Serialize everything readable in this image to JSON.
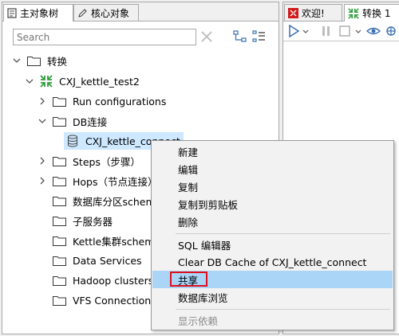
{
  "left_tabs": [
    {
      "label": "主对象树"
    },
    {
      "label": "核心对象"
    }
  ],
  "search": {
    "placeholder": "Search"
  },
  "tree": {
    "root": "转换",
    "transformation": "CXJ_kettle_test2",
    "items": {
      "run_configurations": "Run configurations",
      "db_connections": "DB连接",
      "connection": "CXJ_kettle_connect",
      "steps": "Steps（步骤）",
      "hops": "Hops（节点连接）",
      "partition_schemas": "数据库分区schemas",
      "slave_servers": "子服务器",
      "cluster_schemas": "Kettle集群schemas",
      "data_services": "Data Services",
      "hadoop_clusters": "Hadoop clusters",
      "vfs_connections": "VFS Connections"
    }
  },
  "right_tabs": [
    {
      "label": "欢迎!"
    },
    {
      "label": "转换 1"
    }
  ],
  "context_menu": {
    "new": "新建",
    "edit": "编辑",
    "duplicate": "复制",
    "copy_clipboard": "复制到剪贴板",
    "delete": "删除",
    "sql_editor": "SQL 编辑器",
    "clear_cache": "Clear DB Cache of CXJ_kettle_connect",
    "share": "共享",
    "explore": "数据库浏览",
    "show_dependencies": "显示依赖"
  },
  "colors": {
    "menu_highlight": "#aad5f7",
    "callout_box": "#e0101a",
    "kettle_green": "#2e9e3a"
  }
}
